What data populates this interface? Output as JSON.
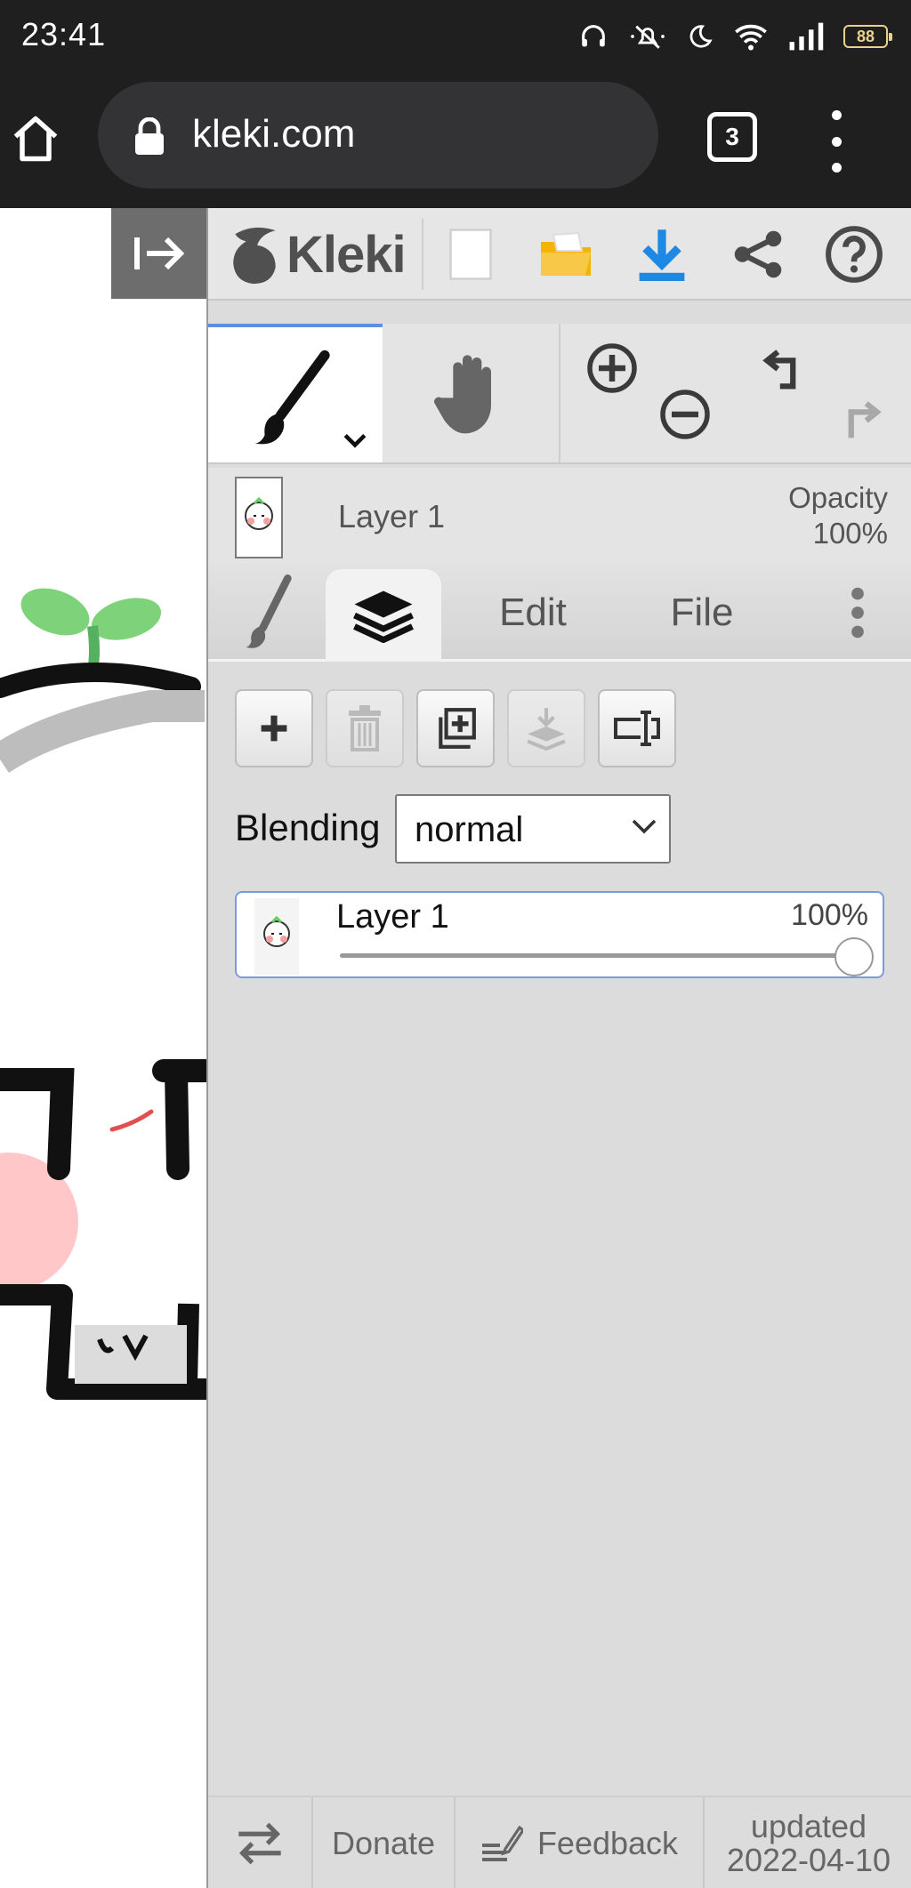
{
  "status_bar": {
    "time": "23:41",
    "battery_level": "88",
    "icons": [
      "headphones-icon",
      "mute-icon",
      "moon-icon",
      "wifi-icon",
      "signal-icon",
      "battery-icon"
    ]
  },
  "browser": {
    "url": "kleki.com",
    "tab_count": "3",
    "icons": [
      "home-icon",
      "lock-icon",
      "overflow-menu-icon"
    ]
  },
  "app": {
    "logo_text": "Kleki",
    "toolbar_icons": [
      "collapse-sidebar-icon",
      "new-image-icon",
      "open-folder-icon",
      "download-icon",
      "share-icon",
      "help-icon"
    ],
    "tools_icons": [
      "brush-icon",
      "hand-icon",
      "zoom-in-icon",
      "zoom-out-icon",
      "undo-icon",
      "redo-icon"
    ],
    "layer_preview": {
      "name": "Layer 1",
      "opacity_label": "Opacity",
      "opacity_value": "100%"
    },
    "tabs": [
      {
        "label": "",
        "icon": "brush-tab-icon"
      },
      {
        "label": "",
        "icon": "layers-icon"
      },
      {
        "label": "Edit"
      },
      {
        "label": "File"
      },
      {
        "label": "",
        "icon": "more-vertical-icon"
      }
    ],
    "layer_buttons": [
      "add-layer-icon",
      "delete-layer-icon",
      "duplicate-layer-icon",
      "merge-down-icon",
      "rename-layer-icon"
    ],
    "blending": {
      "label": "Blending",
      "value": "normal"
    },
    "layers": [
      {
        "name": "Layer 1",
        "opacity": "100%",
        "opacity_fraction": 1.0
      }
    ],
    "footer": {
      "donate": "Donate",
      "feedback": "Feedback",
      "updated_label": "updated",
      "updated_date": "2022-04-10"
    },
    "colors": {
      "accent": "#5f8de0",
      "download": "#1e88e5",
      "folder": "#f4b400",
      "panel": "#dcdcdc"
    }
  }
}
